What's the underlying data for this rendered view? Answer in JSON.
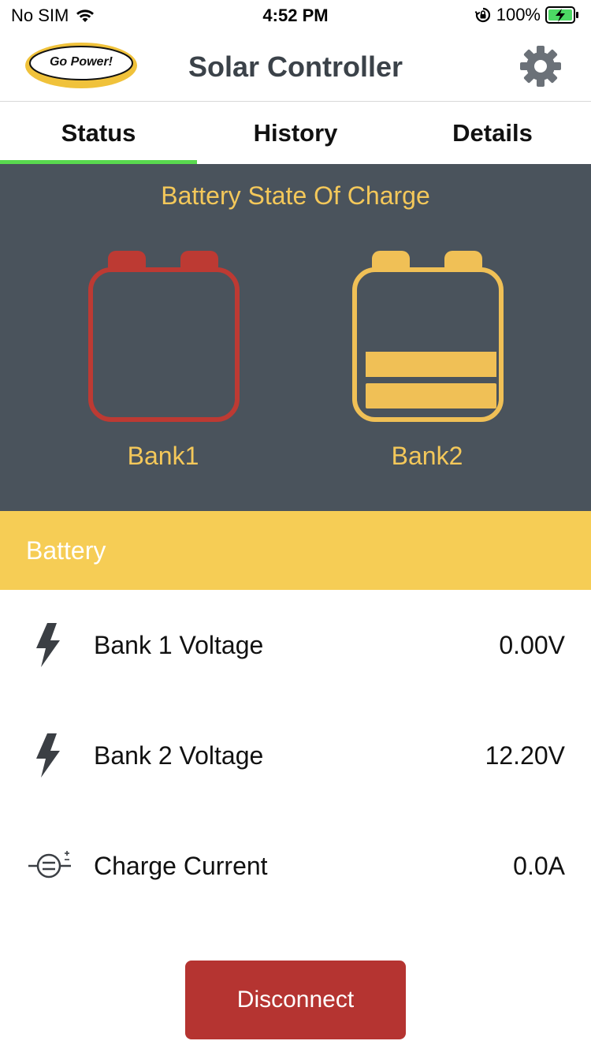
{
  "status_bar": {
    "carrier": "No SIM",
    "time": "4:52 PM",
    "battery_percent": "100%"
  },
  "header": {
    "logo_text": "Go Power!",
    "title": "Solar Controller"
  },
  "tabs": [
    {
      "label": "Status",
      "active": true
    },
    {
      "label": "History",
      "active": false
    },
    {
      "label": "Details",
      "active": false
    }
  ],
  "soc": {
    "title": "Battery State Of Charge",
    "banks": [
      {
        "label": "Bank1",
        "color": "#bd3a33",
        "filled_bars": 0
      },
      {
        "label": "Bank2",
        "color": "#f0c056",
        "filled_bars": 2
      }
    ]
  },
  "battery_section": {
    "title": "Battery",
    "rows": [
      {
        "icon": "lightning-icon",
        "label": "Bank 1 Voltage",
        "value": "0.00V"
      },
      {
        "icon": "lightning-icon",
        "label": "Bank 2 Voltage",
        "value": "12.20V"
      },
      {
        "icon": "current-icon",
        "label": "Charge Current",
        "value": "0.0A"
      }
    ]
  },
  "disconnect_label": "Disconnect",
  "colors": {
    "panel_bg": "#4a535c",
    "accent_yellow": "#f6cd55",
    "danger_red": "#b53431",
    "tab_indicator": "#59d94f"
  }
}
